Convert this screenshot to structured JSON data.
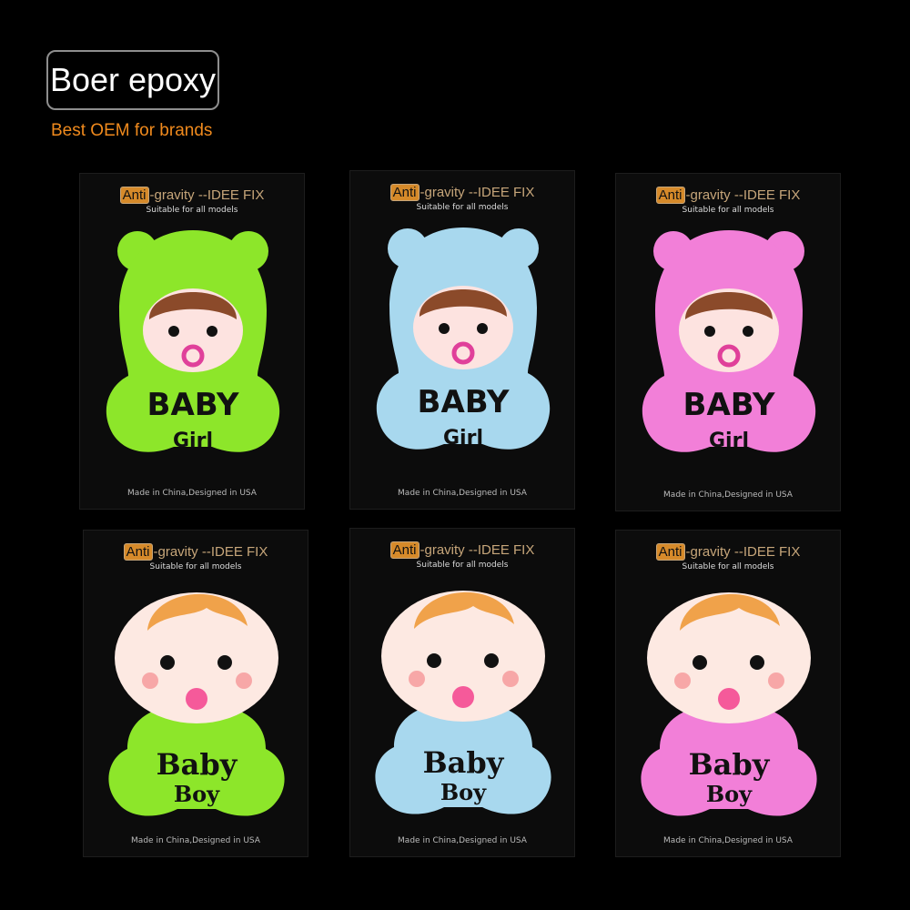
{
  "brand": {
    "title": "Boer epoxy",
    "tagline": "Best OEM for brands"
  },
  "cards": [
    {
      "header_badge": "Anti",
      "header_rest": "-gravity --IDEE FIX",
      "sub": "Suitable for all models",
      "word1": "BABY",
      "word2": "Girl",
      "footer": "Made in China,Designed in USA",
      "color": "#8de62a",
      "type": "girl"
    },
    {
      "header_badge": "Anti",
      "header_rest": "-gravity --IDEE FIX",
      "sub": "Suitable for all models",
      "word1": "BABY",
      "word2": "Girl",
      "footer": "Made in China,Designed in USA",
      "color": "#a8d8ee",
      "type": "girl"
    },
    {
      "header_badge": "Anti",
      "header_rest": "-gravity --IDEE FIX",
      "sub": "Suitable for all models",
      "word1": "BABY",
      "word2": "Girl",
      "footer": "Made in China,Designed in USA",
      "color": "#f27fd8",
      "type": "girl"
    },
    {
      "header_badge": "Anti",
      "header_rest": "-gravity --IDEE FIX",
      "sub": "Suitable for all models",
      "word1": "Baby",
      "word2": "Boy",
      "footer": "Made in China,Designed in USA",
      "color": "#8de62a",
      "type": "boy"
    },
    {
      "header_badge": "Anti",
      "header_rest": "-gravity --IDEE FIX",
      "sub": "Suitable for all models",
      "word1": "Baby",
      "word2": "Boy",
      "footer": "Made in China,Designed in USA",
      "color": "#a8d8ee",
      "type": "boy"
    },
    {
      "header_badge": "Anti",
      "header_rest": "-gravity --IDEE FIX",
      "sub": "Suitable for all models",
      "word1": "Baby",
      "word2": "Boy",
      "footer": "Made in China,Designed in USA",
      "color": "#f27fd8",
      "type": "boy"
    }
  ]
}
